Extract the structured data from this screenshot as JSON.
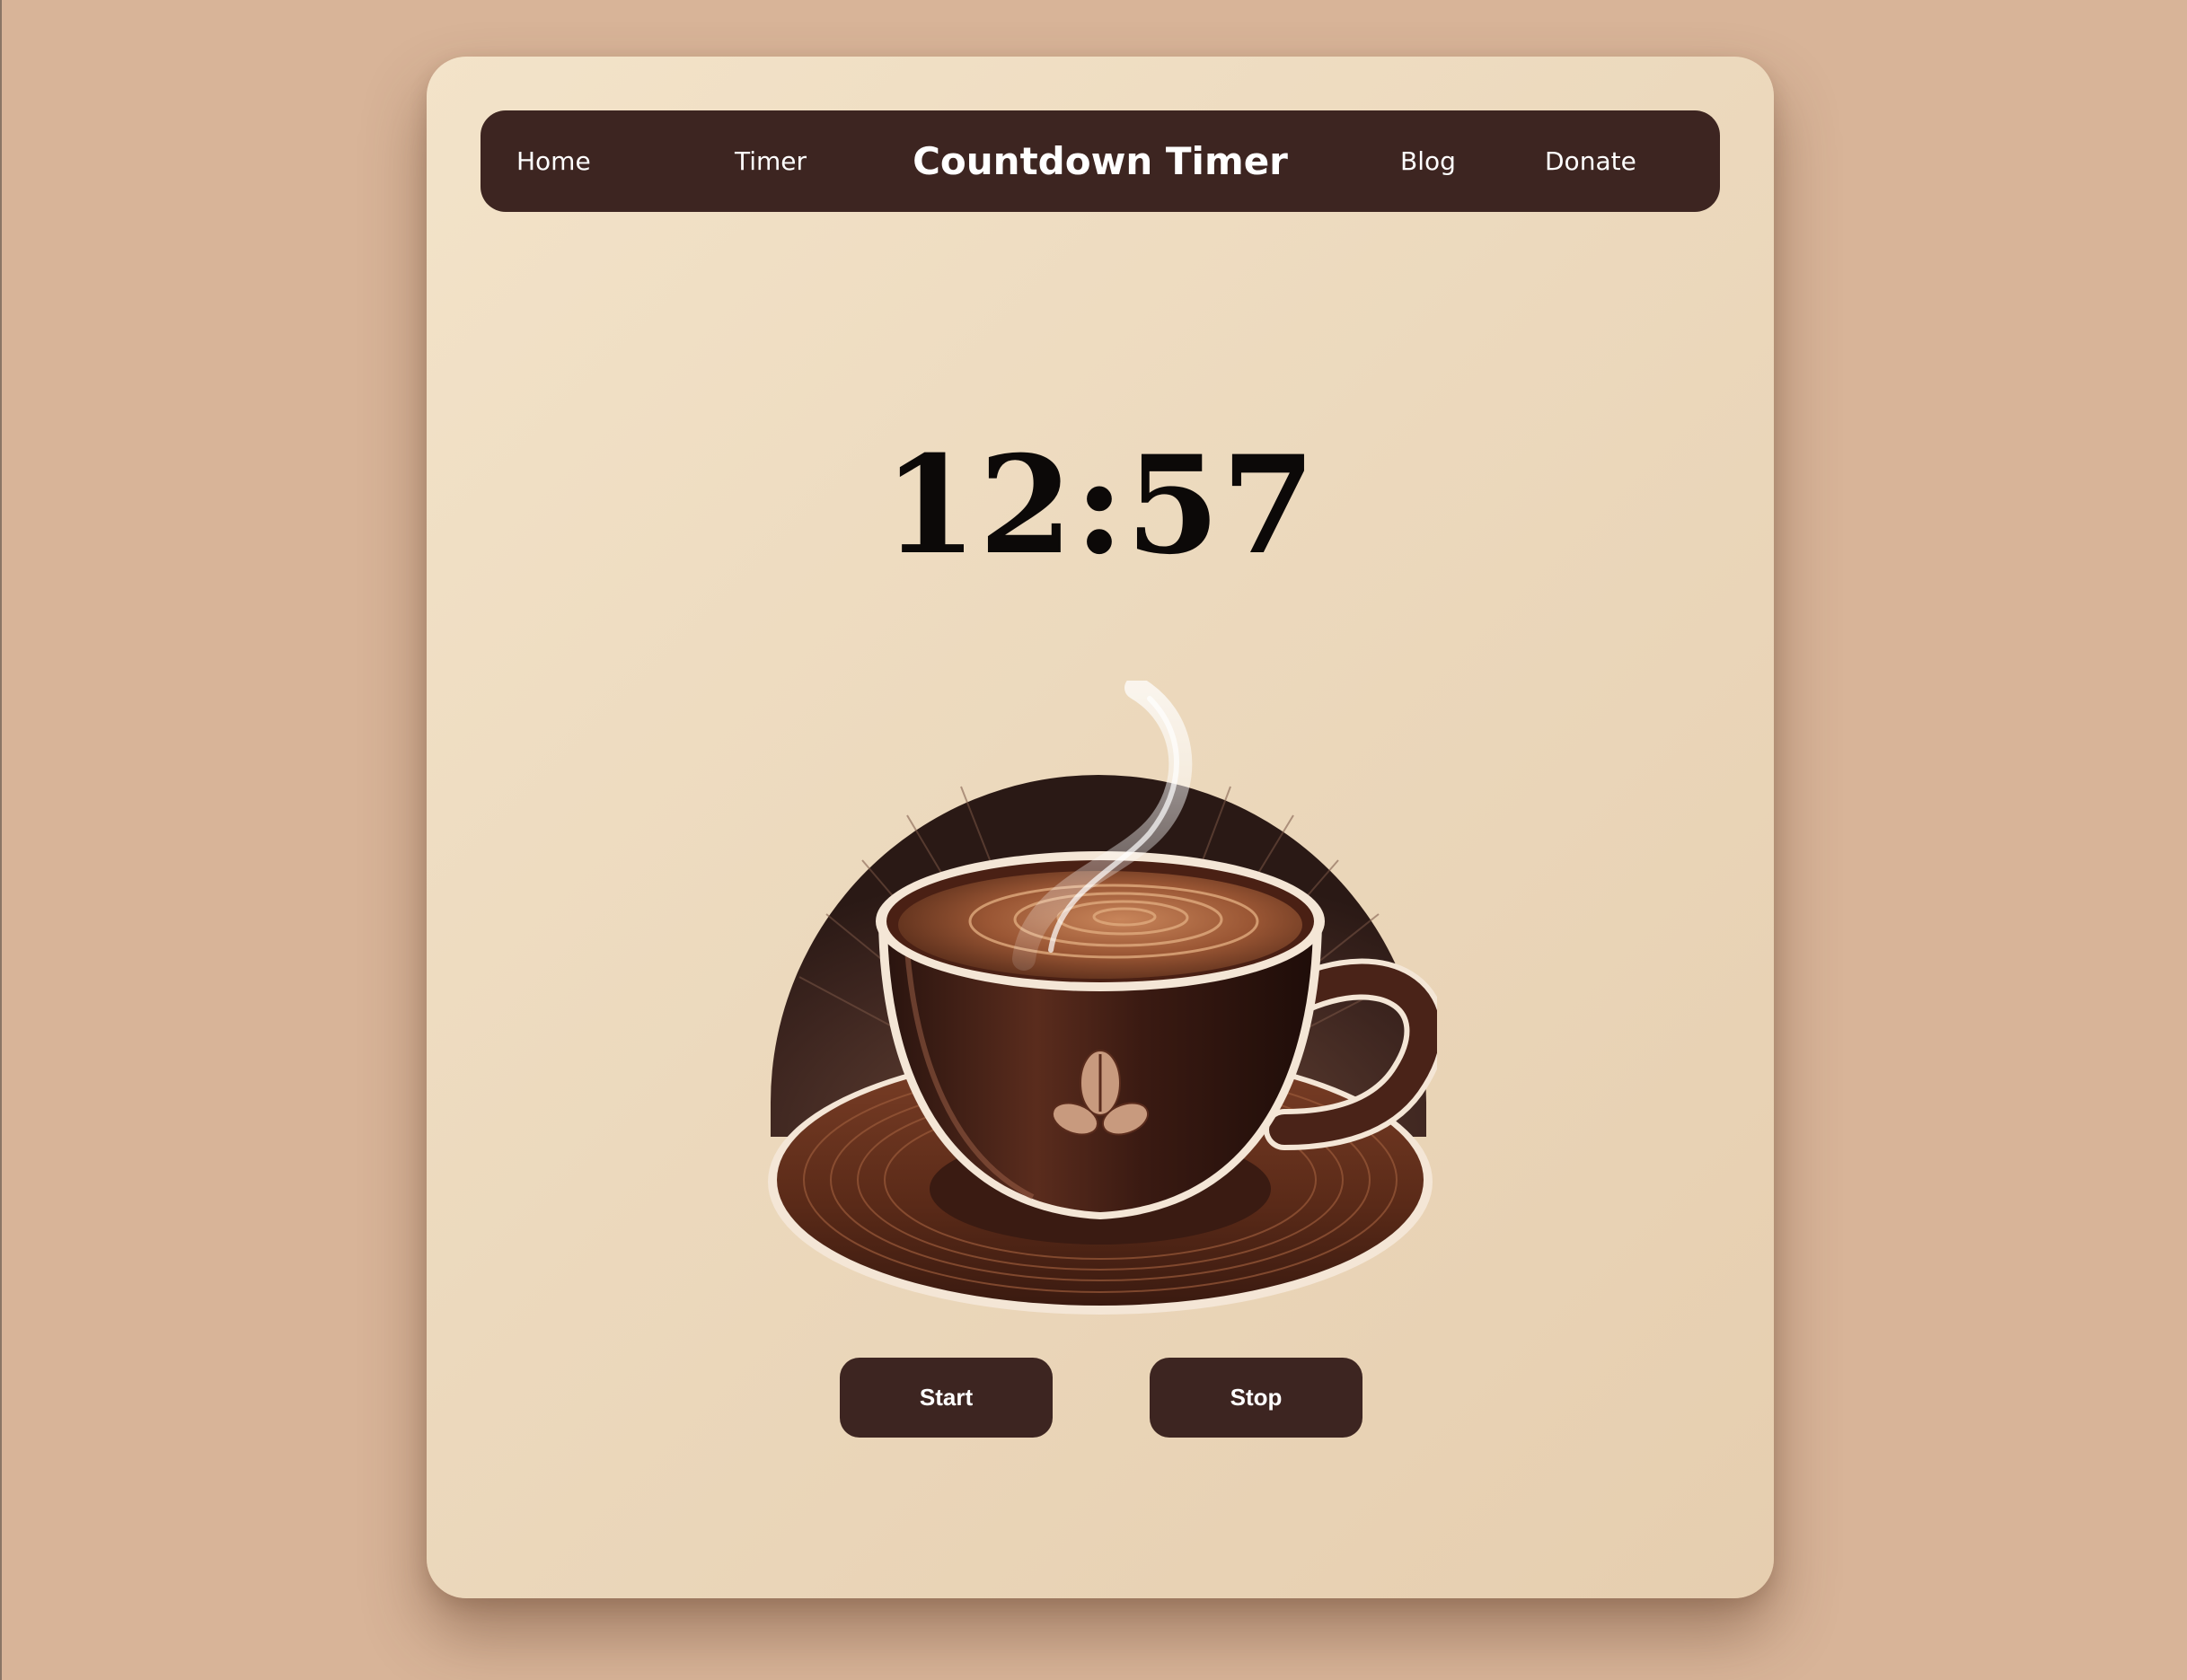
{
  "nav": {
    "home_label": "Home",
    "timer_label": "Timer",
    "brand_title": "Countdown Timer",
    "blog_label": "Blog",
    "donate_label": "Donate"
  },
  "timer": {
    "display": "12:57"
  },
  "illustration": {
    "icon": "coffee-cup-illustration"
  },
  "controls": {
    "start_label": "Start",
    "stop_label": "Stop"
  },
  "colors": {
    "page_background": "#d8b498",
    "card_background": "#f0dfc4",
    "navbar_background": "#3d2521",
    "button_background": "#3d2521",
    "time_text": "#0c0908"
  }
}
